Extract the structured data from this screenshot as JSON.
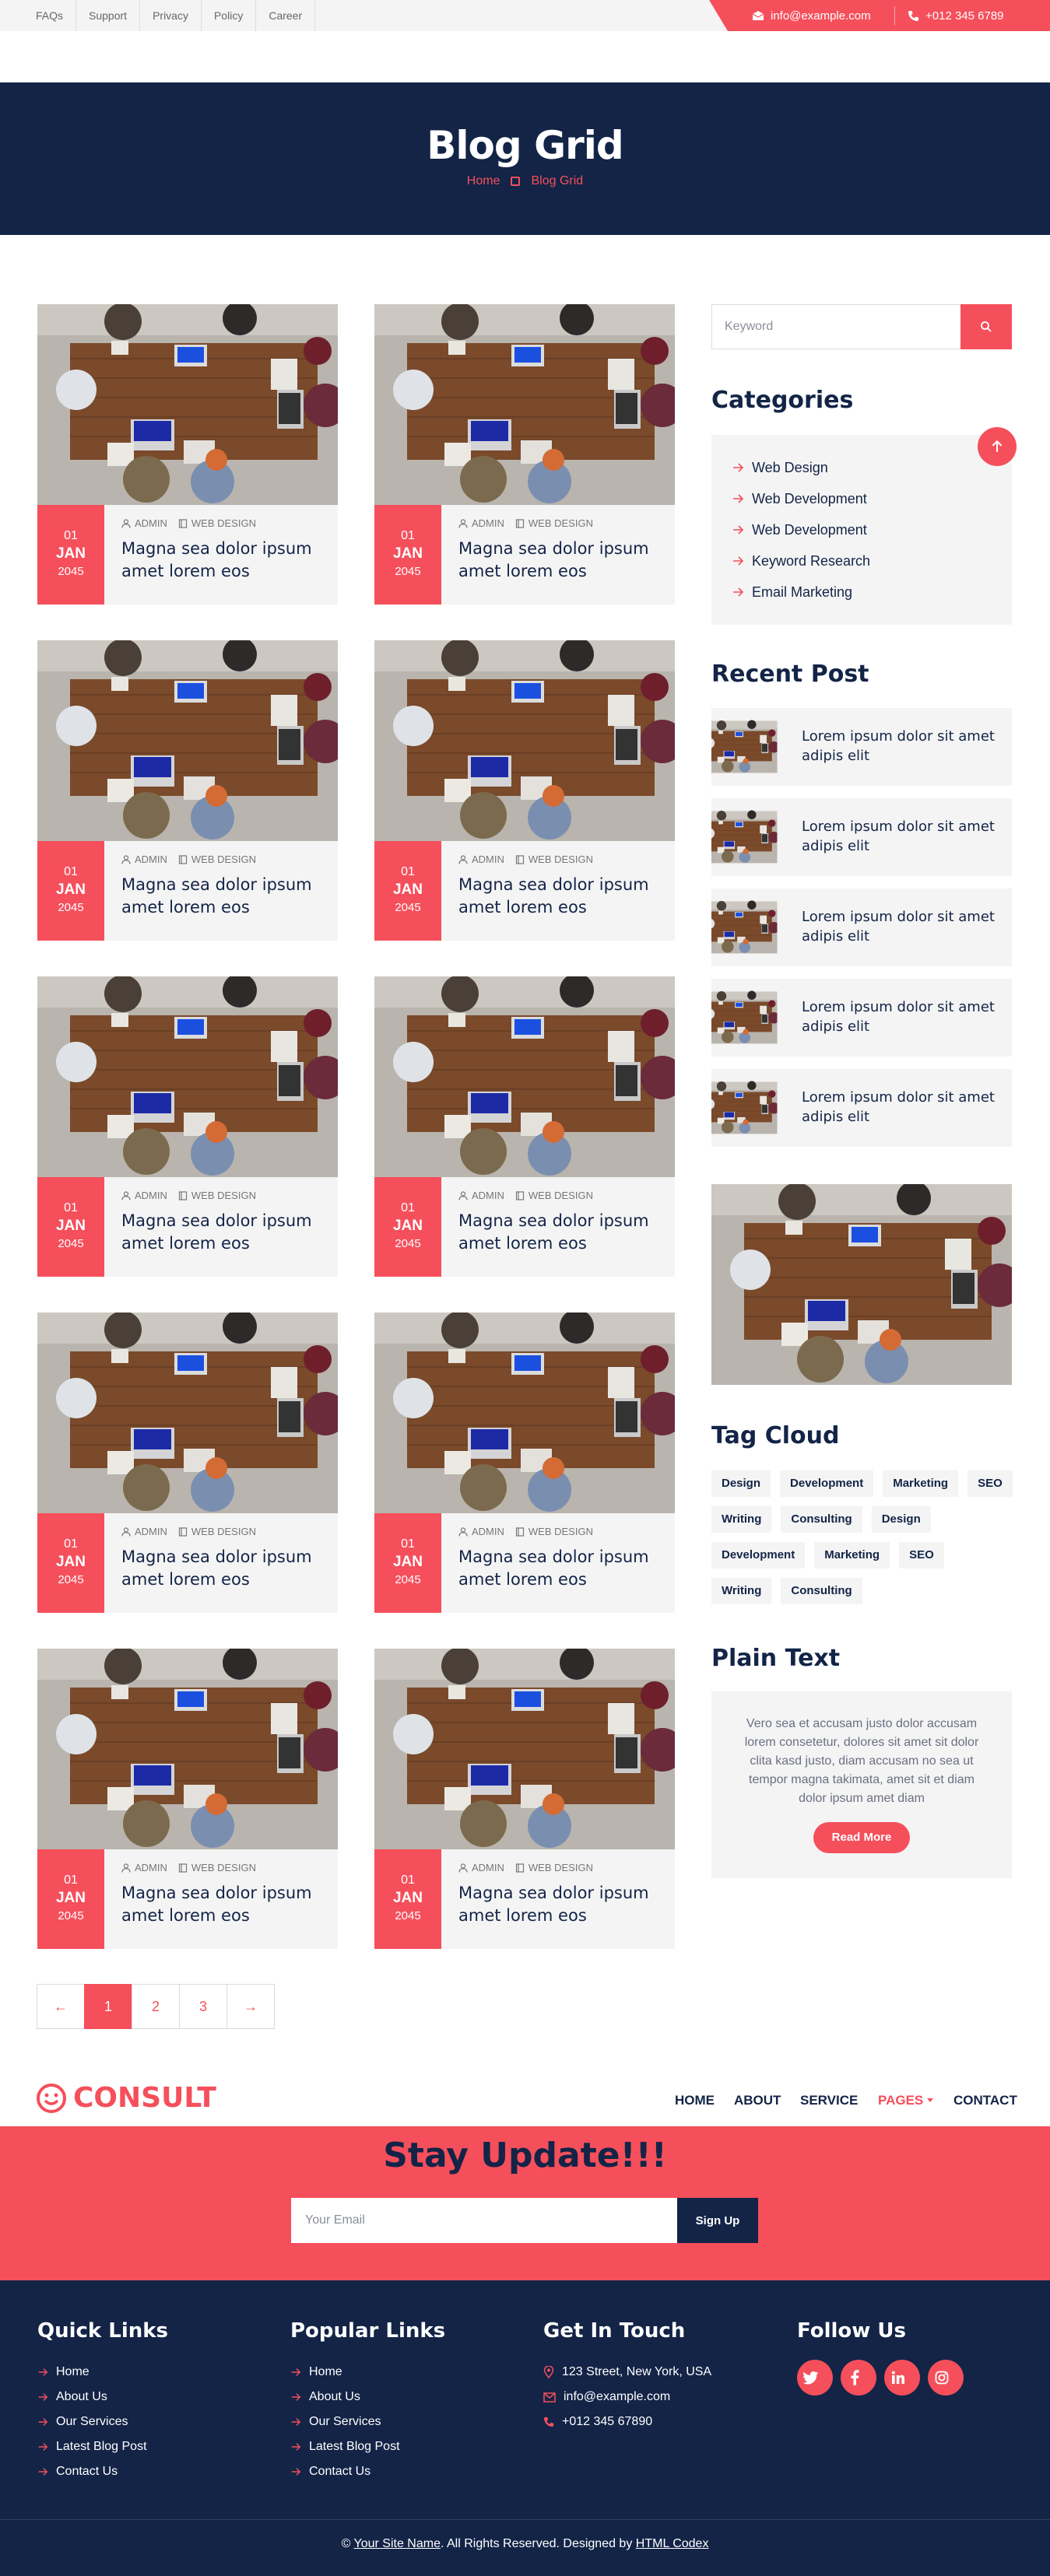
{
  "colors": {
    "accent": "#f54f5b",
    "navy": "#132447",
    "light": "#f4f4f4"
  },
  "topbar": {
    "links": [
      "FAQs",
      "Support",
      "Privacy",
      "Policy",
      "Career"
    ],
    "email": "info@example.com",
    "phone": "+012 345 6789"
  },
  "hero": {
    "title": "Blog Grid",
    "breadcrumb": [
      "Home",
      "Blog Grid"
    ]
  },
  "posts": [
    {
      "day": "01",
      "month": "JAN",
      "year": "2045",
      "author": "ADMIN",
      "category": "WEB DESIGN",
      "title": "Magna sea dolor ipsum amet lorem eos"
    },
    {
      "day": "01",
      "month": "JAN",
      "year": "2045",
      "author": "ADMIN",
      "category": "WEB DESIGN",
      "title": "Magna sea dolor ipsum amet lorem eos"
    },
    {
      "day": "01",
      "month": "JAN",
      "year": "2045",
      "author": "ADMIN",
      "category": "WEB DESIGN",
      "title": "Magna sea dolor ipsum amet lorem eos"
    },
    {
      "day": "01",
      "month": "JAN",
      "year": "2045",
      "author": "ADMIN",
      "category": "WEB DESIGN",
      "title": "Magna sea dolor ipsum amet lorem eos"
    },
    {
      "day": "01",
      "month": "JAN",
      "year": "2045",
      "author": "ADMIN",
      "category": "WEB DESIGN",
      "title": "Magna sea dolor ipsum amet lorem eos"
    },
    {
      "day": "01",
      "month": "JAN",
      "year": "2045",
      "author": "ADMIN",
      "category": "WEB DESIGN",
      "title": "Magna sea dolor ipsum amet lorem eos"
    },
    {
      "day": "01",
      "month": "JAN",
      "year": "2045",
      "author": "ADMIN",
      "category": "WEB DESIGN",
      "title": "Magna sea dolor ipsum amet lorem eos"
    },
    {
      "day": "01",
      "month": "JAN",
      "year": "2045",
      "author": "ADMIN",
      "category": "WEB DESIGN",
      "title": "Magna sea dolor ipsum amet lorem eos"
    },
    {
      "day": "01",
      "month": "JAN",
      "year": "2045",
      "author": "ADMIN",
      "category": "WEB DESIGN",
      "title": "Magna sea dolor ipsum amet lorem eos"
    },
    {
      "day": "01",
      "month": "JAN",
      "year": "2045",
      "author": "ADMIN",
      "category": "WEB DESIGN",
      "title": "Magna sea dolor ipsum amet lorem eos"
    }
  ],
  "pagination": {
    "prev": "←",
    "pages": [
      "1",
      "2",
      "3"
    ],
    "next": "→",
    "current": "1"
  },
  "sidebar": {
    "search_placeholder": "Keyword",
    "categories_title": "Categories",
    "categories": [
      "Web Design",
      "Web Development",
      "Web Development",
      "Keyword Research",
      "Email Marketing"
    ],
    "recent_title": "Recent Post",
    "recent": [
      "Lorem ipsum dolor sit amet adipis elit",
      "Lorem ipsum dolor sit amet adipis elit",
      "Lorem ipsum dolor sit amet adipis elit",
      "Lorem ipsum dolor sit amet adipis elit",
      "Lorem ipsum dolor sit amet adipis elit"
    ],
    "tags_title": "Tag Cloud",
    "tags": [
      "Design",
      "Development",
      "Marketing",
      "SEO",
      "Writing",
      "Consulting",
      "Design",
      "Development",
      "Marketing",
      "SEO",
      "Writing",
      "Consulting"
    ],
    "plain_title": "Plain Text",
    "plain_text": "Vero sea et accusam justo dolor accusam lorem consetetur, dolores sit amet sit dolor clita kasd justo, diam accusam no sea ut tempor magna takimata, amet sit et diam dolor ipsum amet diam",
    "read_more": "Read More"
  },
  "navbar": {
    "logo": "CONSULT",
    "items": [
      "HOME",
      "ABOUT",
      "SERVICE",
      "PAGES",
      "CONTACT"
    ],
    "active": "PAGES"
  },
  "newsletter": {
    "title": "Stay Update!!!",
    "placeholder": "Your Email",
    "button": "Sign Up"
  },
  "footer": {
    "quick_title": "Quick Links",
    "quick_links": [
      "Home",
      "About Us",
      "Our Services",
      "Latest Blog Post",
      "Contact Us"
    ],
    "popular_title": "Popular Links",
    "popular_links": [
      "Home",
      "About Us",
      "Our Services",
      "Latest Blog Post",
      "Contact Us"
    ],
    "touch_title": "Get In Touch",
    "address": "123 Street, New York, USA",
    "email": "info@example.com",
    "phone": "+012 345 67890",
    "follow_title": "Follow Us",
    "social_icons": [
      "twitter-icon",
      "facebook-icon",
      "linkedin-icon",
      "instagram-icon"
    ],
    "copyright_symbol": "©",
    "site_name": "Your Site Name",
    "rights_text": ". All Rights Reserved. Designed by",
    "designer": "HTML Codex"
  }
}
